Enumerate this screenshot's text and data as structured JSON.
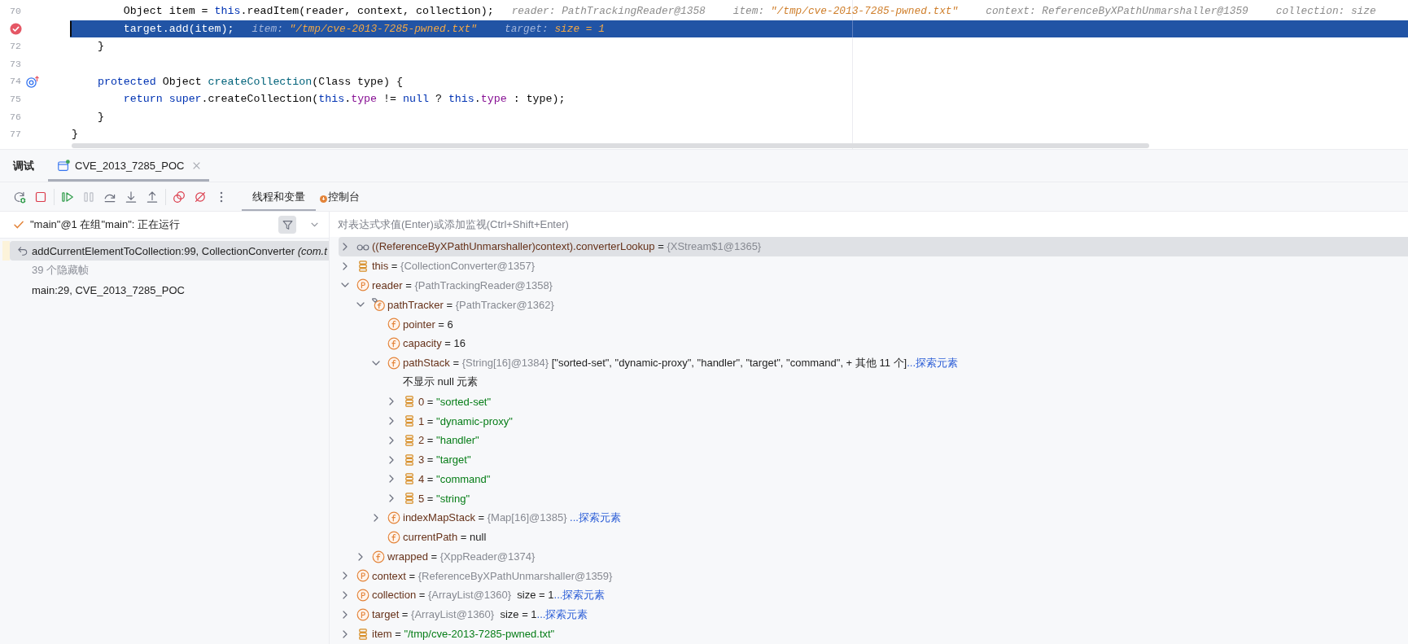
{
  "editor": {
    "lines": [
      {
        "number": "70",
        "breakpoint": false,
        "override": false,
        "highlighted": false,
        "caret": false,
        "code": [
          {
            "kind": "plain",
            "text": "        Object item = "
          },
          {
            "kind": "keyword",
            "text": "this"
          },
          {
            "kind": "plain",
            "text": ".readItem(reader, context, collection);"
          }
        ],
        "hints": [
          {
            "label": "reader:",
            "value": "PathTrackingReader@1358",
            "changed": false
          },
          {
            "label": "item:",
            "value": "\"/tmp/cve-2013-7285-pwned.txt\"",
            "changed": true
          },
          {
            "label": "context:",
            "value": "ReferenceByXPathUnmarshaller@1359",
            "changed": false
          },
          {
            "label": "collection:",
            "value": "size",
            "changed": false
          }
        ]
      },
      {
        "breakpoint": true,
        "override": false,
        "highlighted": true,
        "caret": true,
        "code": [
          {
            "kind": "plain",
            "text": "        target.add(item);"
          }
        ],
        "hints": [
          {
            "label": "item:",
            "value": "\"/tmp/cve-2013-7285-pwned.txt\"",
            "changed": true
          },
          {
            "label": "target:",
            "value": "size = 1",
            "changed": true
          }
        ]
      },
      {
        "number": "72",
        "breakpoint": false,
        "override": false,
        "highlighted": false,
        "caret": false,
        "code": [
          {
            "kind": "plain",
            "text": "    }"
          }
        ]
      },
      {
        "number": "73",
        "breakpoint": false,
        "override": false,
        "highlighted": false,
        "caret": false
      },
      {
        "number": "74",
        "breakpoint": false,
        "override": true,
        "highlighted": false,
        "caret": false,
        "code": [
          {
            "kind": "keyword",
            "text": "    protected"
          },
          {
            "kind": "plain",
            "text": " Object "
          },
          {
            "kind": "method",
            "text": "createCollection"
          },
          {
            "kind": "plain",
            "text": "(Class type) {"
          }
        ]
      },
      {
        "number": "75",
        "breakpoint": false,
        "override": false,
        "highlighted": false,
        "caret": false,
        "code": [
          {
            "kind": "keyword",
            "text": "        return super"
          },
          {
            "kind": "plain",
            "text": ".createCollection("
          },
          {
            "kind": "keyword",
            "text": "this"
          },
          {
            "kind": "plain",
            "text": "."
          },
          {
            "kind": "field",
            "text": "type"
          },
          {
            "kind": "plain",
            "text": " != "
          },
          {
            "kind": "keyword",
            "text": "null"
          },
          {
            "kind": "plain",
            "text": " ? "
          },
          {
            "kind": "keyword",
            "text": "this"
          },
          {
            "kind": "plain",
            "text": "."
          },
          {
            "kind": "field",
            "text": "type"
          },
          {
            "kind": "plain",
            "text": " : type);"
          }
        ]
      },
      {
        "number": "76",
        "breakpoint": false,
        "override": false,
        "highlighted": false,
        "caret": false,
        "code": [
          {
            "kind": "plain",
            "text": "    }"
          }
        ]
      },
      {
        "number": "77",
        "breakpoint": false,
        "override": false,
        "highlighted": false,
        "caret": false,
        "code": [
          {
            "kind": "plain",
            "text": "}"
          }
        ]
      }
    ]
  },
  "debug": {
    "title": "调试",
    "session_tabs": [
      {
        "label": "CVE_2013_7285_POC",
        "selected": true
      }
    ],
    "toolbar": [
      {
        "kind": "rerun",
        "disabled": false
      },
      {
        "kind": "stop",
        "disabled": false
      },
      {
        "kind": "separator"
      },
      {
        "kind": "resume",
        "disabled": false
      },
      {
        "kind": "pause",
        "disabled": true
      },
      {
        "kind": "step_over",
        "disabled": false
      },
      {
        "kind": "step_into",
        "disabled": false
      },
      {
        "kind": "step_out",
        "disabled": false
      },
      {
        "kind": "separator"
      },
      {
        "kind": "breakpoints",
        "disabled": false
      },
      {
        "kind": "mute_breakpoints",
        "disabled": false
      },
      {
        "kind": "more",
        "disabled": false
      }
    ],
    "view_tabs": [
      {
        "label": "线程和变量",
        "selected": true,
        "alert": false
      },
      {
        "label": "控制台",
        "selected": false,
        "alert": true
      }
    ]
  },
  "threads": {
    "current": {
      "label": "\"main\"@1 在组\"main\": 正在运行",
      "running": true
    },
    "frames": [
      {
        "kind": "frame",
        "text": "addCurrentElementToCollection:99, CollectionConverter *(com.t*",
        "selected": true
      },
      {
        "kind": "hidden",
        "text": "39 个隐藏帧",
        "selected": false
      },
      {
        "kind": "frame",
        "text": "main:29, CVE_2013_7285_POC",
        "selected": false
      }
    ]
  },
  "variables": {
    "placeholder": "对表达式求值(Enter)或添加监视(Ctrl+Shift+Enter)",
    "tree": [
      {
        "kind": "watch",
        "selected": true,
        "expanded": false,
        "parts": [
          {
            "kind": "name",
            "text": "((ReferenceByXPathUnmarshaller)context).converterLookup"
          },
          {
            "kind": "op",
            "text": " = "
          },
          {
            "kind": "ref",
            "text": "{XStream$1@1365}"
          }
        ]
      },
      {
        "kind": "variable",
        "selected": false,
        "expanded": false,
        "parts": [
          {
            "kind": "name",
            "text": "this"
          },
          {
            "kind": "op",
            "text": " = "
          },
          {
            "kind": "ref",
            "text": "{CollectionConverter@1357}"
          }
        ]
      },
      {
        "kind": "parameter",
        "selected": false,
        "expanded": true,
        "parts": [
          {
            "kind": "name",
            "text": "reader"
          },
          {
            "kind": "op",
            "text": " = "
          },
          {
            "kind": "ref",
            "text": "{PathTrackingReader@1358}"
          }
        ],
        "children": [
          {
            "kind": "tagged_field",
            "selected": false,
            "expanded": true,
            "parts": [
              {
                "kind": "name",
                "text": "pathTracker"
              },
              {
                "kind": "op",
                "text": " = "
              },
              {
                "kind": "ref",
                "text": "{PathTracker@1362}"
              }
            ],
            "children": [
              {
                "kind": "field",
                "selected": false,
                "parts": [
                  {
                    "kind": "name",
                    "text": "pointer"
                  },
                  {
                    "kind": "op",
                    "text": " = "
                  },
                  {
                    "kind": "plain",
                    "text": "6"
                  }
                ]
              },
              {
                "kind": "field",
                "selected": false,
                "parts": [
                  {
                    "kind": "name",
                    "text": "capacity"
                  },
                  {
                    "kind": "op",
                    "text": " = "
                  },
                  {
                    "kind": "plain",
                    "text": "16"
                  }
                ]
              },
              {
                "kind": "field",
                "selected": false,
                "expanded": true,
                "parts": [
                  {
                    "kind": "name",
                    "text": "pathStack"
                  },
                  {
                    "kind": "op",
                    "text": " = "
                  },
                  {
                    "kind": "ref",
                    "text": "{String[16]@1384}"
                  },
                  {
                    "kind": "plain",
                    "text": " [\"sorted-set\", \"dynamic-proxy\", \"handler\", \"target\", \"command\", + 其他 11 个]"
                  },
                  {
                    "kind": "link",
                    "text": "...探索元素"
                  }
                ],
                "children": [
                  {
                    "kind": "note",
                    "selected": false,
                    "parts": [
                      {
                        "kind": "plain",
                        "text": "不显示 null 元素"
                      }
                    ]
                  },
                  {
                    "kind": "element",
                    "selected": false,
                    "expanded": false,
                    "parts": [
                      {
                        "kind": "name",
                        "text": "0"
                      },
                      {
                        "kind": "op",
                        "text": " = "
                      },
                      {
                        "kind": "string",
                        "text": "\"sorted-set\""
                      }
                    ]
                  },
                  {
                    "kind": "element",
                    "selected": false,
                    "expanded": false,
                    "parts": [
                      {
                        "kind": "name",
                        "text": "1"
                      },
                      {
                        "kind": "op",
                        "text": " = "
                      },
                      {
                        "kind": "string",
                        "text": "\"dynamic-proxy\""
                      }
                    ]
                  },
                  {
                    "kind": "element",
                    "selected": false,
                    "expanded": false,
                    "parts": [
                      {
                        "kind": "name",
                        "text": "2"
                      },
                      {
                        "kind": "op",
                        "text": " = "
                      },
                      {
                        "kind": "string",
                        "text": "\"handler\""
                      }
                    ]
                  },
                  {
                    "kind": "element",
                    "selected": false,
                    "expanded": false,
                    "parts": [
                      {
                        "kind": "name",
                        "text": "3"
                      },
                      {
                        "kind": "op",
                        "text": " = "
                      },
                      {
                        "kind": "string",
                        "text": "\"target\""
                      }
                    ]
                  },
                  {
                    "kind": "element",
                    "selected": false,
                    "expanded": false,
                    "parts": [
                      {
                        "kind": "name",
                        "text": "4"
                      },
                      {
                        "kind": "op",
                        "text": " = "
                      },
                      {
                        "kind": "string",
                        "text": "\"command\""
                      }
                    ]
                  },
                  {
                    "kind": "element",
                    "selected": false,
                    "expanded": false,
                    "parts": [
                      {
                        "kind": "name",
                        "text": "5"
                      },
                      {
                        "kind": "op",
                        "text": " = "
                      },
                      {
                        "kind": "string",
                        "text": "\"string\""
                      }
                    ]
                  }
                ]
              },
              {
                "kind": "field",
                "selected": false,
                "expanded": false,
                "parts": [
                  {
                    "kind": "name",
                    "text": "indexMapStack"
                  },
                  {
                    "kind": "op",
                    "text": " = "
                  },
                  {
                    "kind": "ref",
                    "text": "{Map[16]@1385} "
                  },
                  {
                    "kind": "link",
                    "text": "...探索元素"
                  }
                ]
              },
              {
                "kind": "field",
                "selected": false,
                "parts": [
                  {
                    "kind": "name",
                    "text": "currentPath"
                  },
                  {
                    "kind": "op",
                    "text": " = "
                  },
                  {
                    "kind": "plain",
                    "text": "null"
                  }
                ]
              }
            ]
          },
          {
            "kind": "field",
            "selected": false,
            "expanded": false,
            "parts": [
              {
                "kind": "name",
                "text": "wrapped"
              },
              {
                "kind": "op",
                "text": " = "
              },
              {
                "kind": "ref",
                "text": "{XppReader@1374}"
              }
            ]
          }
        ]
      },
      {
        "kind": "parameter",
        "selected": false,
        "expanded": false,
        "parts": [
          {
            "kind": "name",
            "text": "context"
          },
          {
            "kind": "op",
            "text": " = "
          },
          {
            "kind": "ref",
            "text": "{ReferenceByXPathUnmarshaller@1359}"
          }
        ]
      },
      {
        "kind": "parameter",
        "selected": false,
        "expanded": false,
        "parts": [
          {
            "kind": "name",
            "text": "collection"
          },
          {
            "kind": "op",
            "text": " = "
          },
          {
            "kind": "ref",
            "text": "{ArrayList@1360}"
          },
          {
            "kind": "plain",
            "text": "  size = 1"
          },
          {
            "kind": "link",
            "text": "...探索元素"
          }
        ]
      },
      {
        "kind": "parameter",
        "selected": false,
        "expanded": false,
        "parts": [
          {
            "kind": "name",
            "text": "target"
          },
          {
            "kind": "op",
            "text": " = "
          },
          {
            "kind": "ref",
            "text": "{ArrayList@1360}"
          },
          {
            "kind": "plain",
            "text": "  size = 1"
          },
          {
            "kind": "link",
            "text": "...探索元素"
          }
        ]
      },
      {
        "kind": "variable",
        "selected": false,
        "expanded": false,
        "parts": [
          {
            "kind": "name",
            "text": "item"
          },
          {
            "kind": "op",
            "text": " = "
          },
          {
            "kind": "string",
            "text": "\"/tmp/cve-2013-7285-pwned.txt\""
          }
        ]
      }
    ]
  }
}
